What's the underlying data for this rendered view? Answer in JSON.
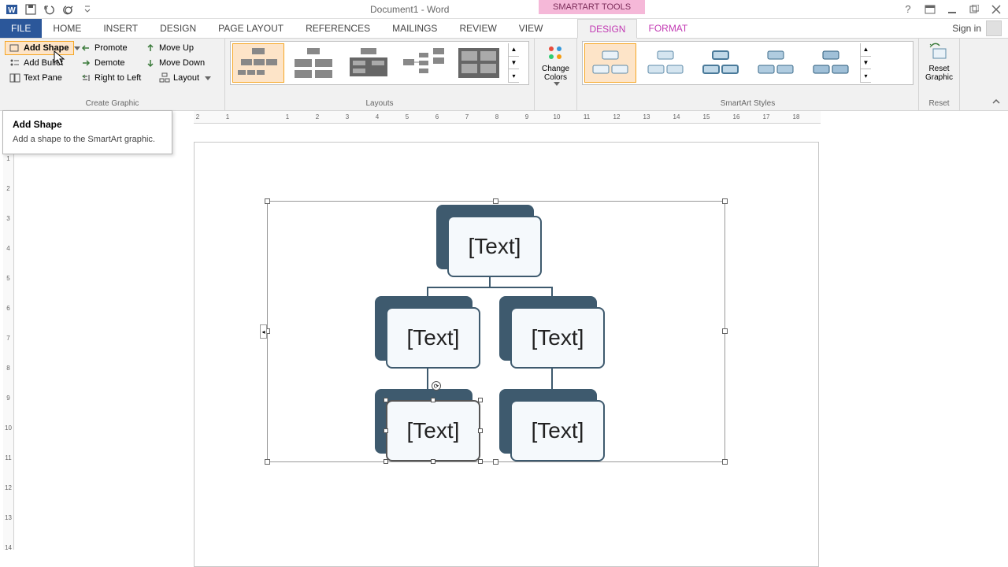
{
  "titlebar": {
    "document_title": "Document1 - Word",
    "smartart_tools": "SMARTART TOOLS"
  },
  "tabs": {
    "file": "FILE",
    "home": "HOME",
    "insert": "INSERT",
    "design": "DESIGN",
    "page_layout": "PAGE LAYOUT",
    "references": "REFERENCES",
    "mailings": "MAILINGS",
    "review": "REVIEW",
    "view": "VIEW",
    "sa_design": "DESIGN",
    "sa_format": "FORMAT",
    "signin": "Sign in"
  },
  "ribbon": {
    "create_graphic": {
      "add_shape": "Add Shape",
      "add_bullet": "Add Bullet",
      "text_pane": "Text Pane",
      "promote": "Promote",
      "demote": "Demote",
      "right_to_left": "Right to Left",
      "move_up": "Move Up",
      "move_down": "Move Down",
      "layout": "Layout",
      "label": "Create Graphic"
    },
    "layouts_label": "Layouts",
    "change_colors": "Change Colors",
    "styles_label": "SmartArt Styles",
    "reset_graphic": "Reset Graphic",
    "reset_label": "Reset"
  },
  "tooltip": {
    "title": "Add Shape",
    "desc": "Add a shape to the SmartArt graphic."
  },
  "smartart": {
    "node1": "[Text]",
    "node2": "[Text]",
    "node3": "[Text]",
    "node4": "[Text]",
    "node5": "[Text]"
  },
  "ruler_h": [
    "2",
    "1",
    "",
    "1",
    "2",
    "3",
    "4",
    "5",
    "6",
    "7",
    "8",
    "9",
    "10",
    "11",
    "12",
    "13",
    "14",
    "15",
    "16",
    "17",
    "18"
  ],
  "ruler_v": [
    "",
    "1",
    "2",
    "3",
    "4",
    "5",
    "6",
    "7",
    "8",
    "9",
    "10",
    "11",
    "12",
    "13",
    "14"
  ]
}
